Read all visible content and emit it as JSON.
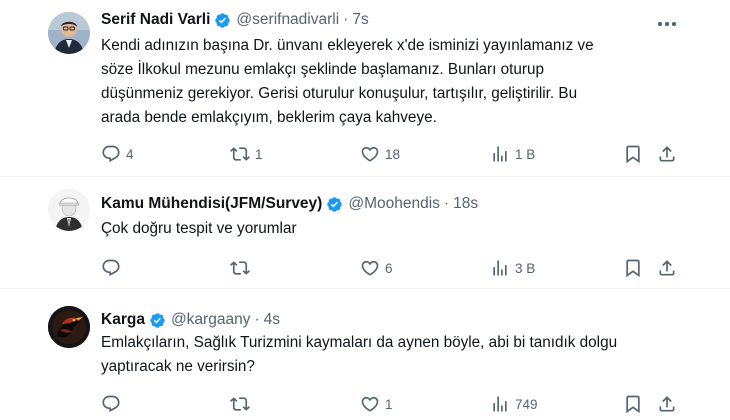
{
  "tweets": [
    {
      "name": "Serif Nadi Varli",
      "handle": "@serifnadivarli",
      "dot": "·",
      "time": "7s",
      "lines": [
        "Kendi adınızın başına Dr. ünvanı ekleyerek x'de isminizi yayınlamanız ve",
        "söze İlkokul mezunu emlakçı şeklinde başlamanız. Bunları oturup",
        "düşünmeniz gerekiyor. Gerisi oturulur konuşulur, tartışılır, geliştirilir. Bu",
        "arada bende emlakçıyım, beklerim çaya kahveye."
      ],
      "replies": "4",
      "reposts": "1",
      "likes": "18",
      "views": "1 B"
    },
    {
      "name": "Kamu Mühendisi(JFM/Survey)",
      "handle": "@Moohendis",
      "dot": "·",
      "time": "18s",
      "lines": [
        "Çok doğru tespit ve yorumlar"
      ],
      "replies": "",
      "reposts": "",
      "likes": "6",
      "views": "3 B"
    },
    {
      "name": "Karga",
      "handle": "@kargaany",
      "dot": "·",
      "time": "4s",
      "lines": [
        "Emlakçıların, Sağlık Turizmini kaymaları da aynen böyle, abi bi tanıdık dolgu",
        "yaptıracak ne verirsin?"
      ],
      "replies": "",
      "reposts": "",
      "likes": "1",
      "views": "749"
    }
  ],
  "icons": {
    "reply": "reply-icon",
    "repost": "repost-icon",
    "like": "heart-icon",
    "views": "views-icon",
    "bookmark": "bookmark-icon",
    "share": "share-icon",
    "verified": "verified-badge-icon",
    "more": "more-icon"
  },
  "colors": {
    "verified": "#1d9bf0",
    "text": "#0f1419",
    "secondary": "#536471",
    "divider": "#eff3f4"
  }
}
